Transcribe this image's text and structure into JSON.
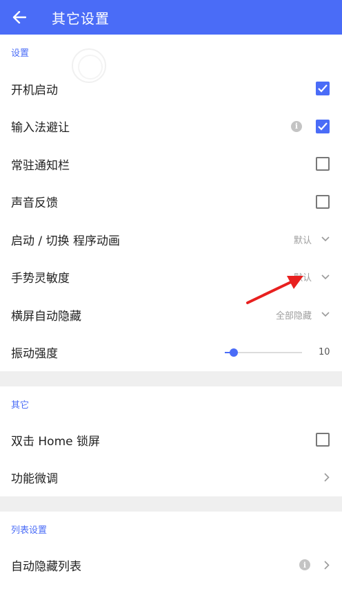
{
  "appbar": {
    "title": "其它设置",
    "back_icon": "arrow-left-icon"
  },
  "sections": {
    "settings": {
      "header": "设置",
      "items": [
        {
          "label": "开机启动",
          "control": "checkbox",
          "checked": true
        },
        {
          "label": "输入法避让",
          "control": "checkbox",
          "checked": true,
          "info": "i"
        },
        {
          "label": "常驻通知栏",
          "control": "checkbox",
          "checked": false
        },
        {
          "label": "声音反馈",
          "control": "checkbox",
          "checked": false
        },
        {
          "label": "启动 / 切换 程序动画",
          "control": "dropdown",
          "value": "默认"
        },
        {
          "label": "手势灵敏度",
          "control": "dropdown",
          "value": "默认"
        },
        {
          "label": "横屏自动隐藏",
          "control": "dropdown",
          "value": "全部隐藏"
        },
        {
          "label": "振动强度",
          "control": "slider",
          "value": "10",
          "fraction": 0.12
        }
      ]
    },
    "other": {
      "header": "其它",
      "items": [
        {
          "label": "双击 Home 锁屏",
          "control": "checkbox",
          "checked": false
        },
        {
          "label": "功能微调",
          "control": "chevron"
        }
      ]
    },
    "list": {
      "header": "列表设置",
      "items": [
        {
          "label": "自动隐藏列表",
          "control": "chevron",
          "info": "i"
        }
      ]
    }
  },
  "colors": {
    "accent": "#4a6cf7",
    "annotation": "#e8201f"
  }
}
